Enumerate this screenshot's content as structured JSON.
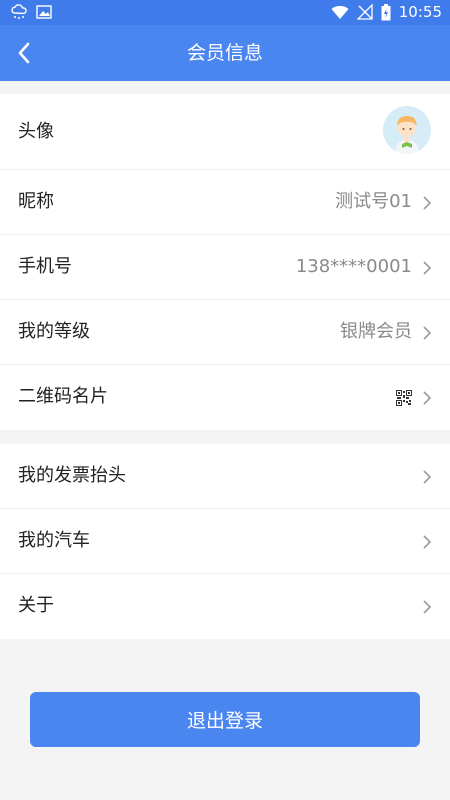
{
  "status_bar": {
    "time": "10:55"
  },
  "header": {
    "title": "会员信息"
  },
  "profile": {
    "avatar_label": "头像",
    "nickname_label": "昵称",
    "nickname_value": "测试号01",
    "phone_label": "手机号",
    "phone_value": "138****0001",
    "level_label": "我的等级",
    "level_value": "银牌会员",
    "qrcard_label": "二维码名片"
  },
  "more": {
    "invoice_label": "我的发票抬头",
    "car_label": "我的汽车",
    "about_label": "关于"
  },
  "logout_label": "退出登录",
  "colors": {
    "primary": "#4a86f0",
    "status_bar": "#3f7bea",
    "background": "#f4f4f4"
  }
}
